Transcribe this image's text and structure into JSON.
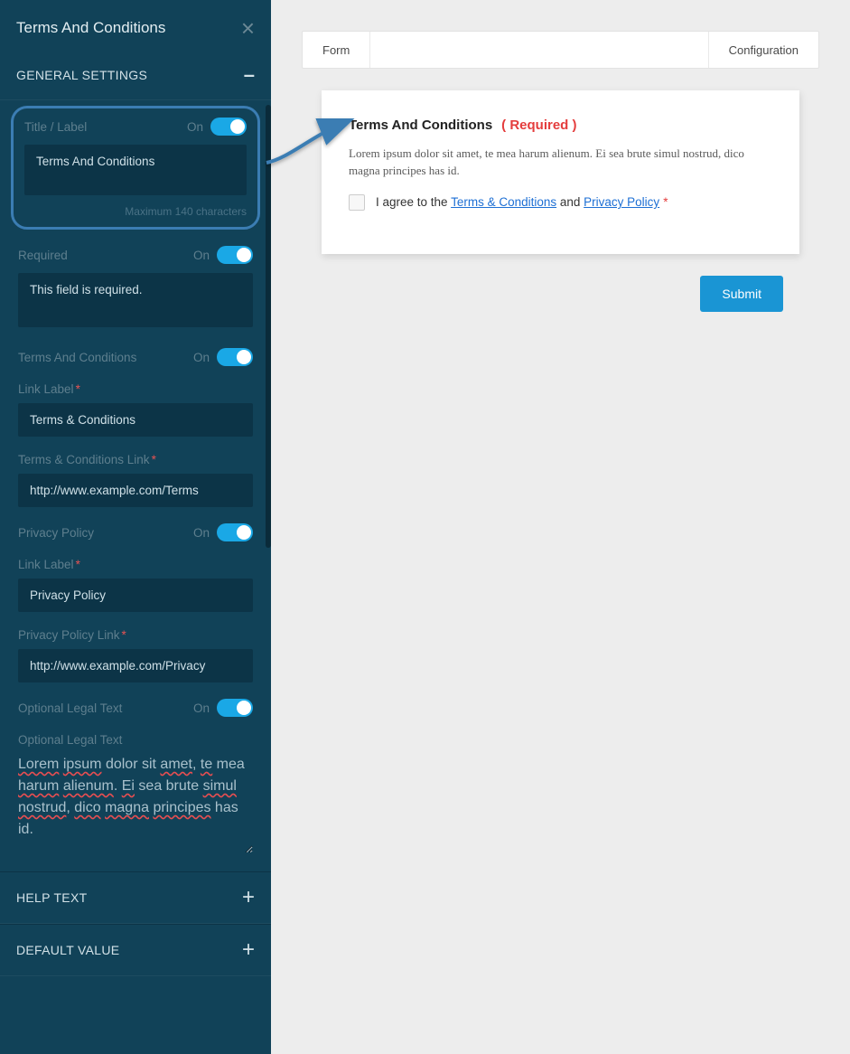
{
  "sidebar": {
    "title": "Terms And Conditions",
    "section_general": "GENERAL SETTINGS",
    "toggle_on": "On",
    "title_label": "Title / Label",
    "title_value": "Terms And Conditions",
    "title_help": "Maximum 140 characters",
    "required_label": "Required",
    "required_value": "This field is required.",
    "tc_label": "Terms And Conditions",
    "link_label": "Link Label",
    "tc_link_value": "Terms & Conditions",
    "tc_url_label": "Terms & Conditions Link",
    "tc_url_value": "http://www.example.com/Terms",
    "pp_label": "Privacy Policy",
    "pp_link_value": "Privacy Policy",
    "pp_url_label": "Privacy Policy Link",
    "pp_url_value": "http://www.example.com/Privacy",
    "opt_legal_label": "Optional Legal Text",
    "opt_legal_input_label": "Optional Legal Text",
    "opt_legal_value": "Lorem ipsum dolor sit amet, te mea harum alienum. Ei sea brute simul nostrud, dico magna principes has id.",
    "section_help": "HELP TEXT",
    "section_default": "DEFAULT VALUE"
  },
  "tabs": {
    "form": "Form",
    "config": "Configuration"
  },
  "card": {
    "title": "Terms And Conditions",
    "required": "( Required )",
    "text": "Lorem ipsum dolor sit amet, te mea harum alienum. Ei sea brute simul nostrud, dico magna principes has id.",
    "agree_prefix": "I agree to the ",
    "tc_link": "Terms & Conditions",
    "and": " and ",
    "pp_link": "Privacy Policy"
  },
  "submit": "Submit"
}
